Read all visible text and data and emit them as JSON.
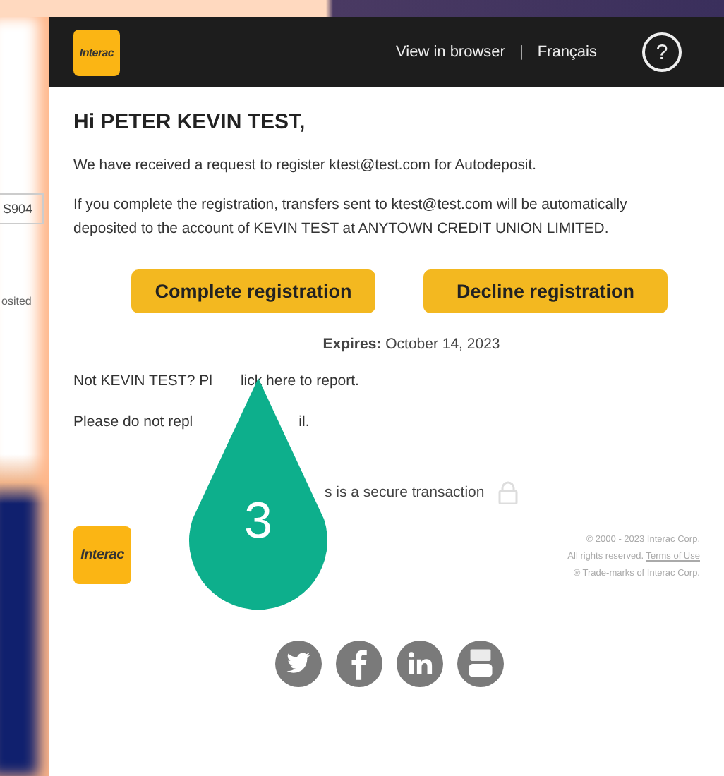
{
  "background_panel": {
    "field_value": "S904",
    "text_fragment": "osited"
  },
  "email": {
    "header": {
      "logo_text": "Interac",
      "view_in_browser": "View in browser",
      "separator": "|",
      "language": "Français",
      "help": "?"
    },
    "greeting": "Hi PETER KEVIN TEST,",
    "paragraphs": [
      "We have received a request to register ktest@test.com for Autodeposit.",
      "If you complete the registration, transfers sent to ktest@test.com will be automatically deposited to the account of KEVIN TEST at ANYTOWN CREDIT UNION LIMITED."
    ],
    "buttons": [
      "Complete registration",
      "Decline registration"
    ],
    "expires": "**Expires:** October 14, 2023",
    "report_line": [
      "Not KEVIN TEST? Pl",
      "lick here to report."
    ],
    "no_reply_line": [
      "Please do not repl",
      "il."
    ],
    "secure_line": "s is a secure transaction",
    "footer": {
      "logo_text": "Interac",
      "lines": [
        "© 2000 - 2023 Interac Corp.",
        "All rights reserved."
      ],
      "terms_link": "Terms of Use",
      "trademark": "® Trade-marks of Interac Corp."
    }
  },
  "marker": {
    "label": "3"
  }
}
